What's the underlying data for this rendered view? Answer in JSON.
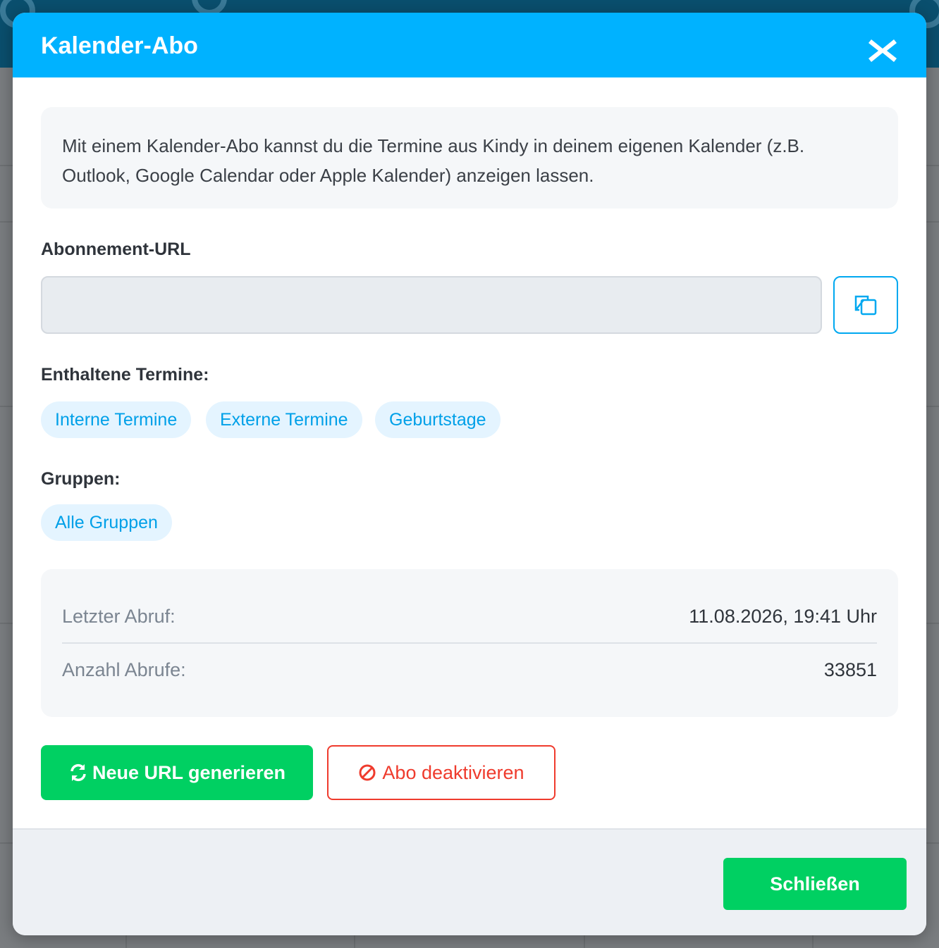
{
  "modal": {
    "title": "Kalender-Abo",
    "info_text": "Mit einem Kalender-Abo kannst du die Termine aus Kindy in deinem eigenen Kalender (z.B. Outlook, Google Calendar oder Apple Kalender) anzeigen lassen.",
    "url_label": "Abonnement-URL",
    "url_value": "",
    "events_label": "Enthaltene Termine:",
    "event_types": [
      "Interne Termine",
      "Externe Termine",
      "Geburtstage"
    ],
    "groups_label": "Gruppen:",
    "groups": [
      "Alle Gruppen"
    ],
    "stats": {
      "last_fetch_label": "Letzter Abruf:",
      "last_fetch_value": "11.08.2026, 19:41 Uhr",
      "count_label": "Anzahl Abrufe:",
      "count_value": "33851"
    },
    "generate_label": "Neue URL generieren",
    "deactivate_label": "Abo deaktivieren",
    "close_label": "Schließen"
  },
  "icons": {
    "close": "close-icon",
    "copy": "copy-icon",
    "refresh": "refresh-icon",
    "ban": "ban-icon"
  },
  "colors": {
    "header": "#00b2ff",
    "primary_green": "#00d062",
    "danger_red": "#ef3b2d",
    "chip_bg": "#e4f4ff",
    "chip_text": "#00a0e8"
  }
}
